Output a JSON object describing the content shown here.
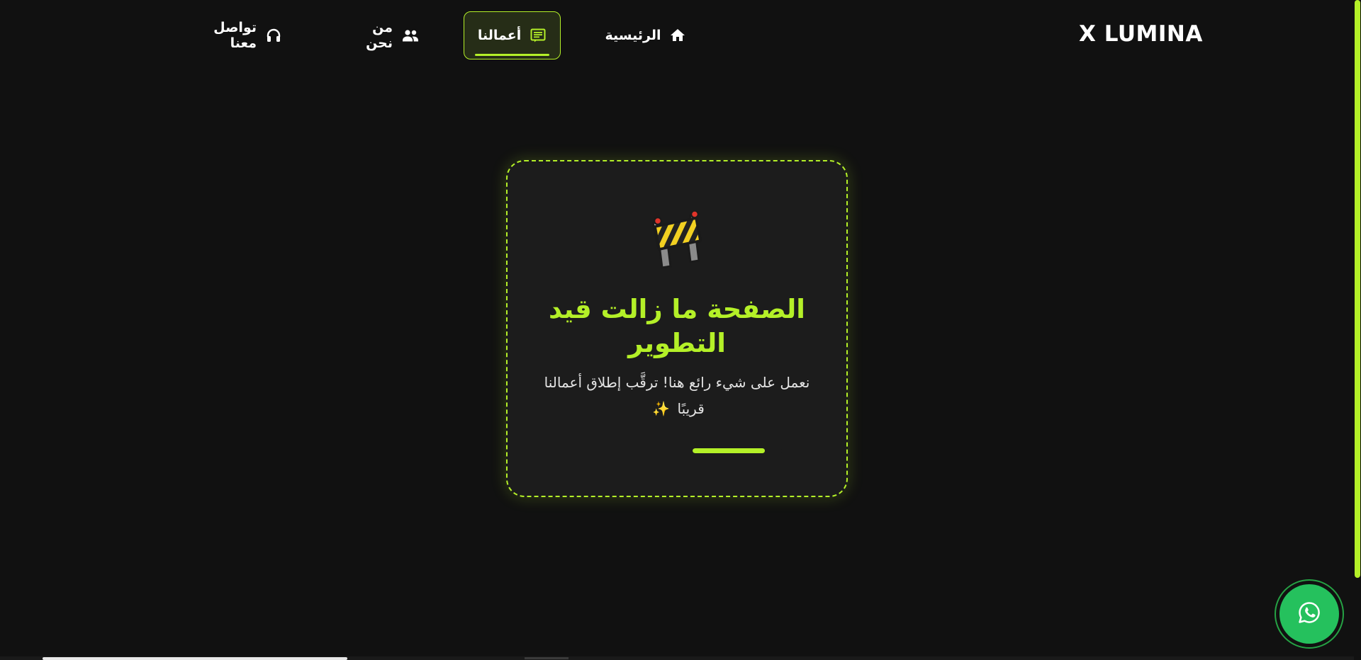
{
  "brand": {
    "logo": "X LUMINA"
  },
  "nav": {
    "home": "الرئيسية",
    "work": "أعمالنا",
    "about": "من نحن",
    "contact": "تواصل معنا",
    "active": "work"
  },
  "card": {
    "icon": "construction-barrier-icon",
    "title": "الصفحة ما زالت قيد التطوير",
    "subtitle": "نعمل على شيء رائع هنا! ترقَّب إطلاق أعمالنا قريبًا",
    "sparkle": "✨",
    "progress": 0.81
  },
  "floating": {
    "icon": "whatsapp-icon"
  },
  "colors": {
    "accent": "#b4f028",
    "background": "#111111",
    "card": "#1c1c1c",
    "whatsapp": "#25c15d"
  }
}
